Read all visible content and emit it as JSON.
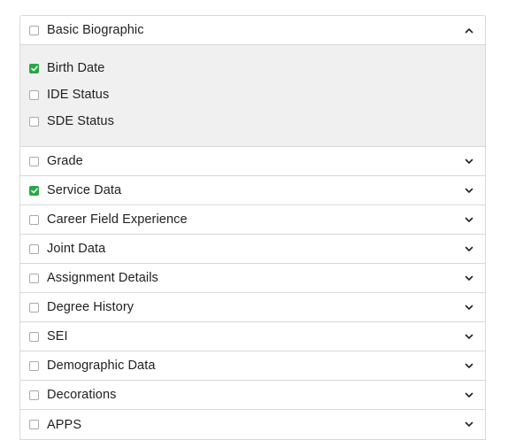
{
  "section": {
    "label": "Basic Biographic",
    "checked": false,
    "expanded": true,
    "children": [
      {
        "label": "Birth Date",
        "checked": true
      },
      {
        "label": "IDE Status",
        "checked": false
      },
      {
        "label": "SDE Status",
        "checked": false
      }
    ]
  },
  "groups": [
    {
      "label": "Grade",
      "checked": false
    },
    {
      "label": "Service Data",
      "checked": true
    },
    {
      "label": "Career Field Experience",
      "checked": false
    },
    {
      "label": "Joint Data",
      "checked": false
    },
    {
      "label": "Assignment Details",
      "checked": false
    },
    {
      "label": "Degree History",
      "checked": false
    },
    {
      "label": "SEI",
      "checked": false
    },
    {
      "label": "Demographic Data",
      "checked": false
    },
    {
      "label": "Decorations",
      "checked": false
    },
    {
      "label": "APPS",
      "checked": false
    }
  ],
  "colors": {
    "check": "#28a745",
    "border": "#d9d9d9",
    "expanded_bg": "#f0f0f0"
  },
  "icons": {
    "collapse": "chevron-up-icon",
    "expand": "chevron-down-icon",
    "check": "checkmark-icon"
  }
}
